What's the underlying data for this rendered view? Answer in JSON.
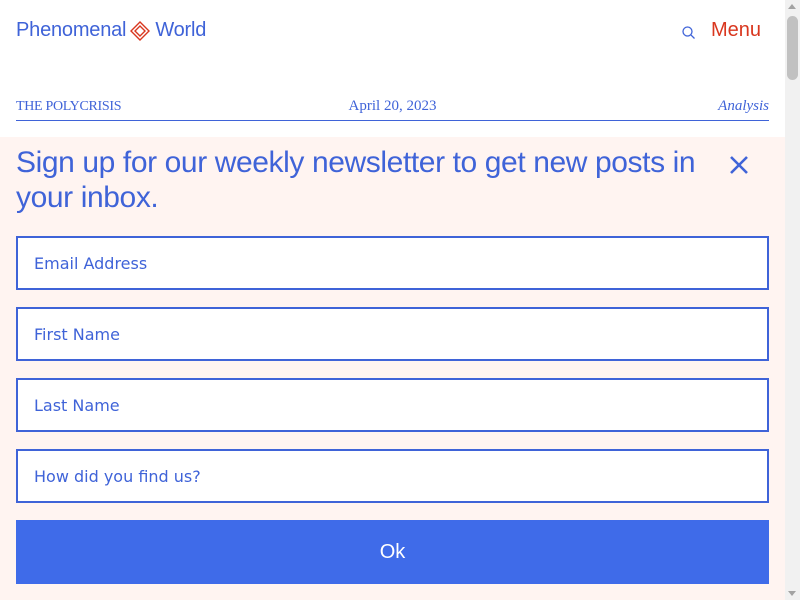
{
  "colors": {
    "brand_blue": "#3f63d8",
    "menu_red": "#d9371f",
    "overlay_bg": "#fff4f1",
    "button_blue": "#3f6be9"
  },
  "header": {
    "logo_left": "Phenomenal",
    "logo_right": "World",
    "logo_icon": "diamond-icon",
    "search_icon": "search-icon",
    "menu_label": "Menu"
  },
  "article_meta": {
    "series": "THE POLYCRISIS",
    "date": "April 20, 2023",
    "category": "Analysis"
  },
  "newsletter": {
    "heading": "Sign up for our weekly newsletter to get new posts in your inbox.",
    "close_icon": "close-icon",
    "fields": {
      "email": {
        "placeholder": "Email Address",
        "value": ""
      },
      "first_name": {
        "placeholder": "First Name",
        "value": ""
      },
      "last_name": {
        "placeholder": "Last Name",
        "value": ""
      },
      "source": {
        "placeholder": "How did you find us?",
        "value": ""
      }
    },
    "submit_label": "Ok"
  }
}
